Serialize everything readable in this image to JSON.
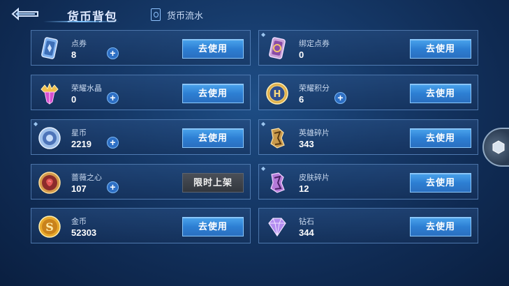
{
  "header": {
    "title": "货币背包",
    "flow_tab_label": "货币流水"
  },
  "currencies": [
    {
      "name": "点券",
      "amount": "8",
      "has_plus": true,
      "action": "去使用",
      "icon": "coupon-card-icon",
      "corner_tag": false
    },
    {
      "name": "绑定点券",
      "amount": "0",
      "has_plus": false,
      "action": "去使用",
      "icon": "bound-coupon-card-icon",
      "corner_tag": true
    },
    {
      "name": "荣耀水晶",
      "amount": "0",
      "has_plus": true,
      "action": "去使用",
      "icon": "glory-crystal-icon",
      "corner_tag": false
    },
    {
      "name": "荣耀积分",
      "amount": "6",
      "has_plus": true,
      "action": "去使用",
      "icon": "glory-points-icon",
      "corner_tag": false
    },
    {
      "name": "星币",
      "amount": "2219",
      "has_plus": true,
      "action": "去使用",
      "icon": "star-coin-icon",
      "corner_tag": true
    },
    {
      "name": "英雄碎片",
      "amount": "343",
      "has_plus": false,
      "action": "去使用",
      "icon": "hero-fragment-icon",
      "corner_tag": true
    },
    {
      "name": "蔷薇之心",
      "amount": "107",
      "has_plus": true,
      "action": "限时上架",
      "icon": "rose-heart-icon",
      "corner_tag": false
    },
    {
      "name": "皮肤碎片",
      "amount": "12",
      "has_plus": false,
      "action": "去使用",
      "icon": "skin-fragment-icon",
      "corner_tag": true
    },
    {
      "name": "金币",
      "amount": "52303",
      "has_plus": false,
      "action": "去使用",
      "icon": "gold-coin-icon",
      "corner_tag": false
    },
    {
      "name": "钻石",
      "amount": "344",
      "has_plus": false,
      "action": "去使用",
      "icon": "diamond-icon",
      "corner_tag": false
    }
  ]
}
